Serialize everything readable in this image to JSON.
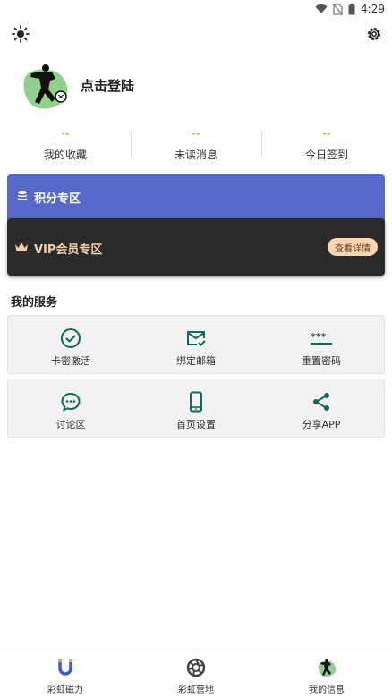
{
  "status_bar": {
    "time": "4:29"
  },
  "profile": {
    "login_label": "点击登陆"
  },
  "stats": [
    {
      "value": "--",
      "label": "我的收藏"
    },
    {
      "value": "--",
      "label": "未读消息"
    },
    {
      "value": "--",
      "label": "今日签到"
    }
  ],
  "points": {
    "title": "积分专区"
  },
  "vip": {
    "title": "VIP会员专区",
    "button_label": "查看详情"
  },
  "services": {
    "title": "我的服务",
    "items": [
      {
        "label": "卡密激活",
        "icon": "check-circle-icon"
      },
      {
        "label": "绑定邮箱",
        "icon": "mail-check-icon"
      },
      {
        "label": "重置密码",
        "icon": "password-icon"
      },
      {
        "label": "讨论区",
        "icon": "chat-icon"
      },
      {
        "label": "首页设置",
        "icon": "phone-icon"
      },
      {
        "label": "分享APP",
        "icon": "share-icon"
      }
    ]
  },
  "bottom_nav": [
    {
      "label": "彩虹磁力",
      "icon": "magnet-icon"
    },
    {
      "label": "彩虹营地",
      "icon": "camera-aperture-icon"
    },
    {
      "label": "我的信息",
      "icon": "avatar-icon"
    }
  ],
  "colors": {
    "accent": "#0e6b5e",
    "points_bg": "#5669c8",
    "vip_bg": "#2a2a2a",
    "vip_text": "#f2cfa5",
    "stat_value": "#f0a73a"
  }
}
